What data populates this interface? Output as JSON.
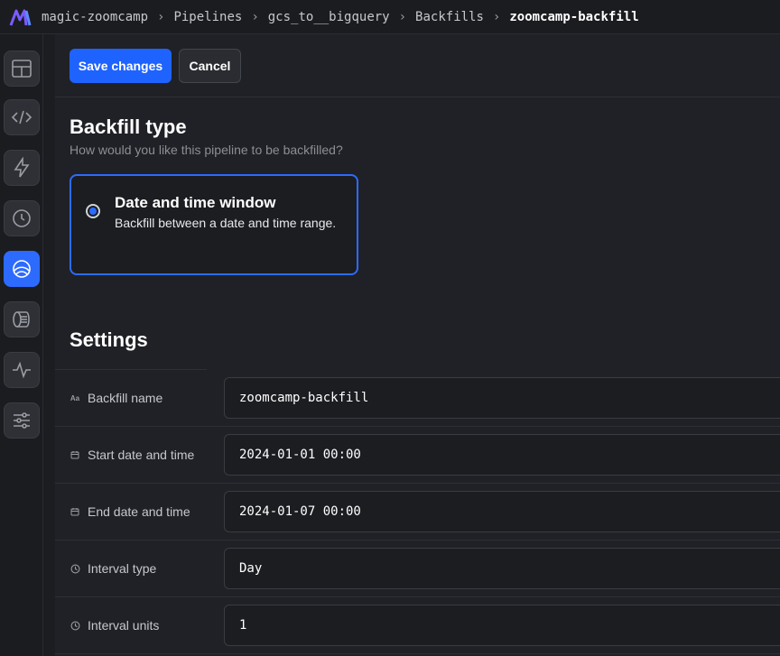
{
  "breadcrumbs": [
    "magic-zoomcamp",
    "Pipelines",
    "gcs_to__bigquery",
    "Backfills",
    "zoomcamp-backfill"
  ],
  "sidebar": {
    "items": [
      {
        "icon": "layout-icon",
        "active": false
      },
      {
        "icon": "code-icon",
        "active": false
      },
      {
        "icon": "lightning-icon",
        "active": false
      },
      {
        "icon": "clock-icon",
        "active": false
      },
      {
        "icon": "backfill-icon",
        "active": true
      },
      {
        "icon": "drum-icon",
        "active": false
      },
      {
        "icon": "pulse-icon",
        "active": false
      },
      {
        "icon": "sliders-icon",
        "active": false
      }
    ]
  },
  "toolbar": {
    "save_label": "Save changes",
    "cancel_label": "Cancel"
  },
  "backfill_type": {
    "title": "Backfill type",
    "subtitle": "How would you like this pipeline to be backfilled?",
    "option": {
      "title": "Date and time window",
      "description": "Backfill between a date and time range.",
      "selected": true
    }
  },
  "settings": {
    "title": "Settings",
    "rows": [
      {
        "icon": "text-icon",
        "label": "Backfill name",
        "value": "zoomcamp-backfill"
      },
      {
        "icon": "calendar-icon",
        "label": "Start date and time",
        "value": "2024-01-01 00:00"
      },
      {
        "icon": "calendar-icon",
        "label": "End date and time",
        "value": "2024-01-07 00:00"
      },
      {
        "icon": "clock-icon",
        "label": "Interval type",
        "value": "Day"
      },
      {
        "icon": "clock-icon",
        "label": "Interval units",
        "value": "1"
      }
    ]
  },
  "colors": {
    "accent": "#1f63ff",
    "background": "#202126"
  }
}
